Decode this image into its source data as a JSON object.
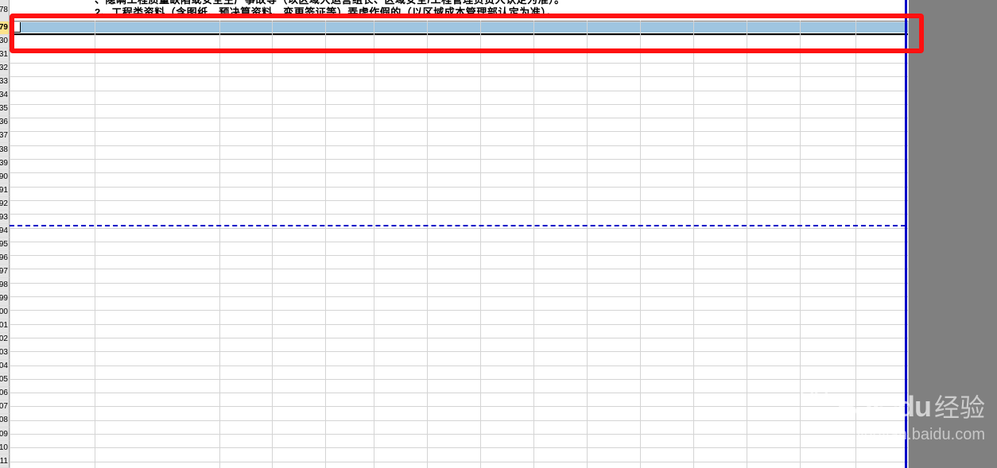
{
  "text_content": {
    "line1_partial": "、隐瞒工程质量缺陷或安全生产事故等（以区域大运营组长、区域安全/工程管理负责人认定为准）。",
    "line2": "2、工程类资料（含图纸、预决算资料、变更签证等）弄虚作假的（以区域成本管理部认定为准）。"
  },
  "row_numbers": [
    "78",
    "79",
    "30",
    "31",
    "32",
    "33",
    "34",
    "35",
    "36",
    "37",
    "38",
    "39",
    "90",
    "91",
    "92",
    "93",
    "94",
    "95",
    "96",
    "97",
    "98",
    "99",
    "00",
    "01",
    "02",
    "03",
    "04",
    "05",
    "06",
    "07",
    "08",
    "09",
    "10",
    "11"
  ],
  "annotation": {
    "highlight_color": "#ff1010",
    "selection_color": "#9fc5e0"
  },
  "watermark": {
    "brand": "Bai",
    "brand2": "du",
    "product": "经验",
    "url": "jingyan.baidu.com"
  },
  "grid": {
    "row_height": 17.3,
    "column_positions": [
      0,
      107,
      264,
      330,
      397,
      458,
      525,
      592,
      659,
      726,
      793,
      860,
      927,
      994,
      1064,
      1130,
      1180,
      1242
    ]
  }
}
